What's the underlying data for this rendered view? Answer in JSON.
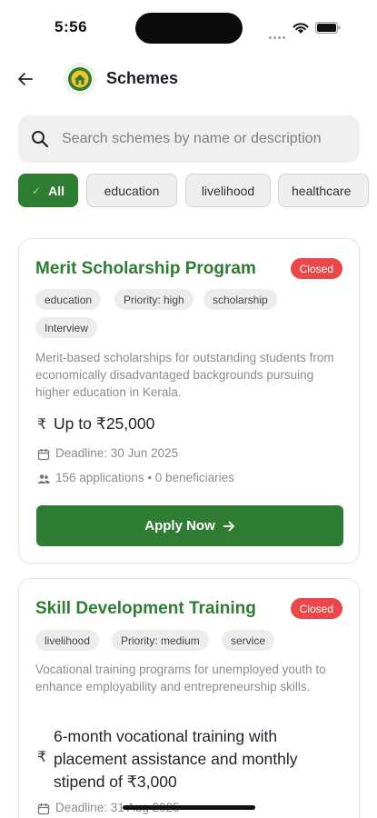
{
  "status_bar": {
    "time": "5:56"
  },
  "app_bar": {
    "title": "Schemes"
  },
  "search": {
    "placeholder": "Search schemes by name or description",
    "value": ""
  },
  "filters": {
    "chips": [
      {
        "label": "All",
        "selected": true
      },
      {
        "label": "education",
        "selected": false
      },
      {
        "label": "livelihood",
        "selected": false
      },
      {
        "label": "healthcare",
        "selected": false
      }
    ]
  },
  "schemes": [
    {
      "title": "Merit Scholarship Program",
      "status": "Closed",
      "tags": [
        "education",
        "Priority: high",
        "scholarship",
        "Interview"
      ],
      "description": "Merit-based scholarships for outstanding students from economically disadvantaged backgrounds pursuing higher education in Kerala.",
      "benefit": "Up to ₹25,000",
      "deadline": "Deadline: 30 Jun 2025",
      "stats": "156 applications • 0 beneficiaries",
      "action_label": "Apply Now"
    },
    {
      "title": "Skill Development Training",
      "status": "Closed",
      "tags": [
        "livelihood",
        "Priority: medium",
        "service"
      ],
      "description": "Vocational training programs for unemployed youth to enhance employability and entrepreneurship skills.",
      "benefit": "6-month vocational training with placement assistance and monthly stipend of ₹3,000",
      "deadline": "Deadline: 31 Aug 2025"
    }
  ],
  "colors": {
    "primary_green": "#2e7d32",
    "closed_badge": "#e9474a",
    "chip_background": "#eeeeee",
    "muted_text": "#8a8d90"
  },
  "icons": {
    "back": "arrow-left-icon",
    "logo": "home-badge-icon",
    "search": "search-icon",
    "rupee": "rupee-icon",
    "calendar": "calendar-icon",
    "people": "people-icon",
    "apply_arrow": "arrow-right-icon"
  }
}
